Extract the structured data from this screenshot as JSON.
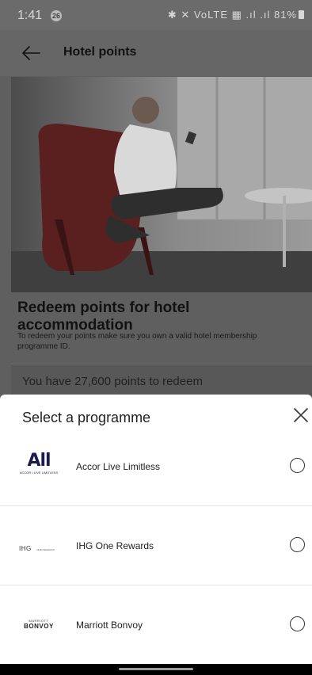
{
  "status_bar": {
    "time": "1:41",
    "notification_count": "26",
    "icons_text": "✱ ✕ VoLTE ▦ .ıl .ıl",
    "battery": "81%"
  },
  "app_bar": {
    "title": "Hotel points"
  },
  "content": {
    "headline": "Redeem points for hotel accommodation",
    "description": "To redeem your points make sure you own a valid hotel membership programme ID.",
    "points_text": "You have 27,600 points to redeem"
  },
  "sheet": {
    "title": "Select a programme",
    "options": [
      {
        "label": "Accor Live Limitless",
        "logo_main": "All",
        "logo_sub": "ACCOR • LIVE LIMITLESS"
      },
      {
        "label": "IHG One Rewards",
        "logo_main": "IHG",
        "logo_sub": "ONE REWARDS"
      },
      {
        "label": "Marriott Bonvoy",
        "logo_main": "BONVOY",
        "logo_sub": "MARRIOTT"
      }
    ]
  }
}
